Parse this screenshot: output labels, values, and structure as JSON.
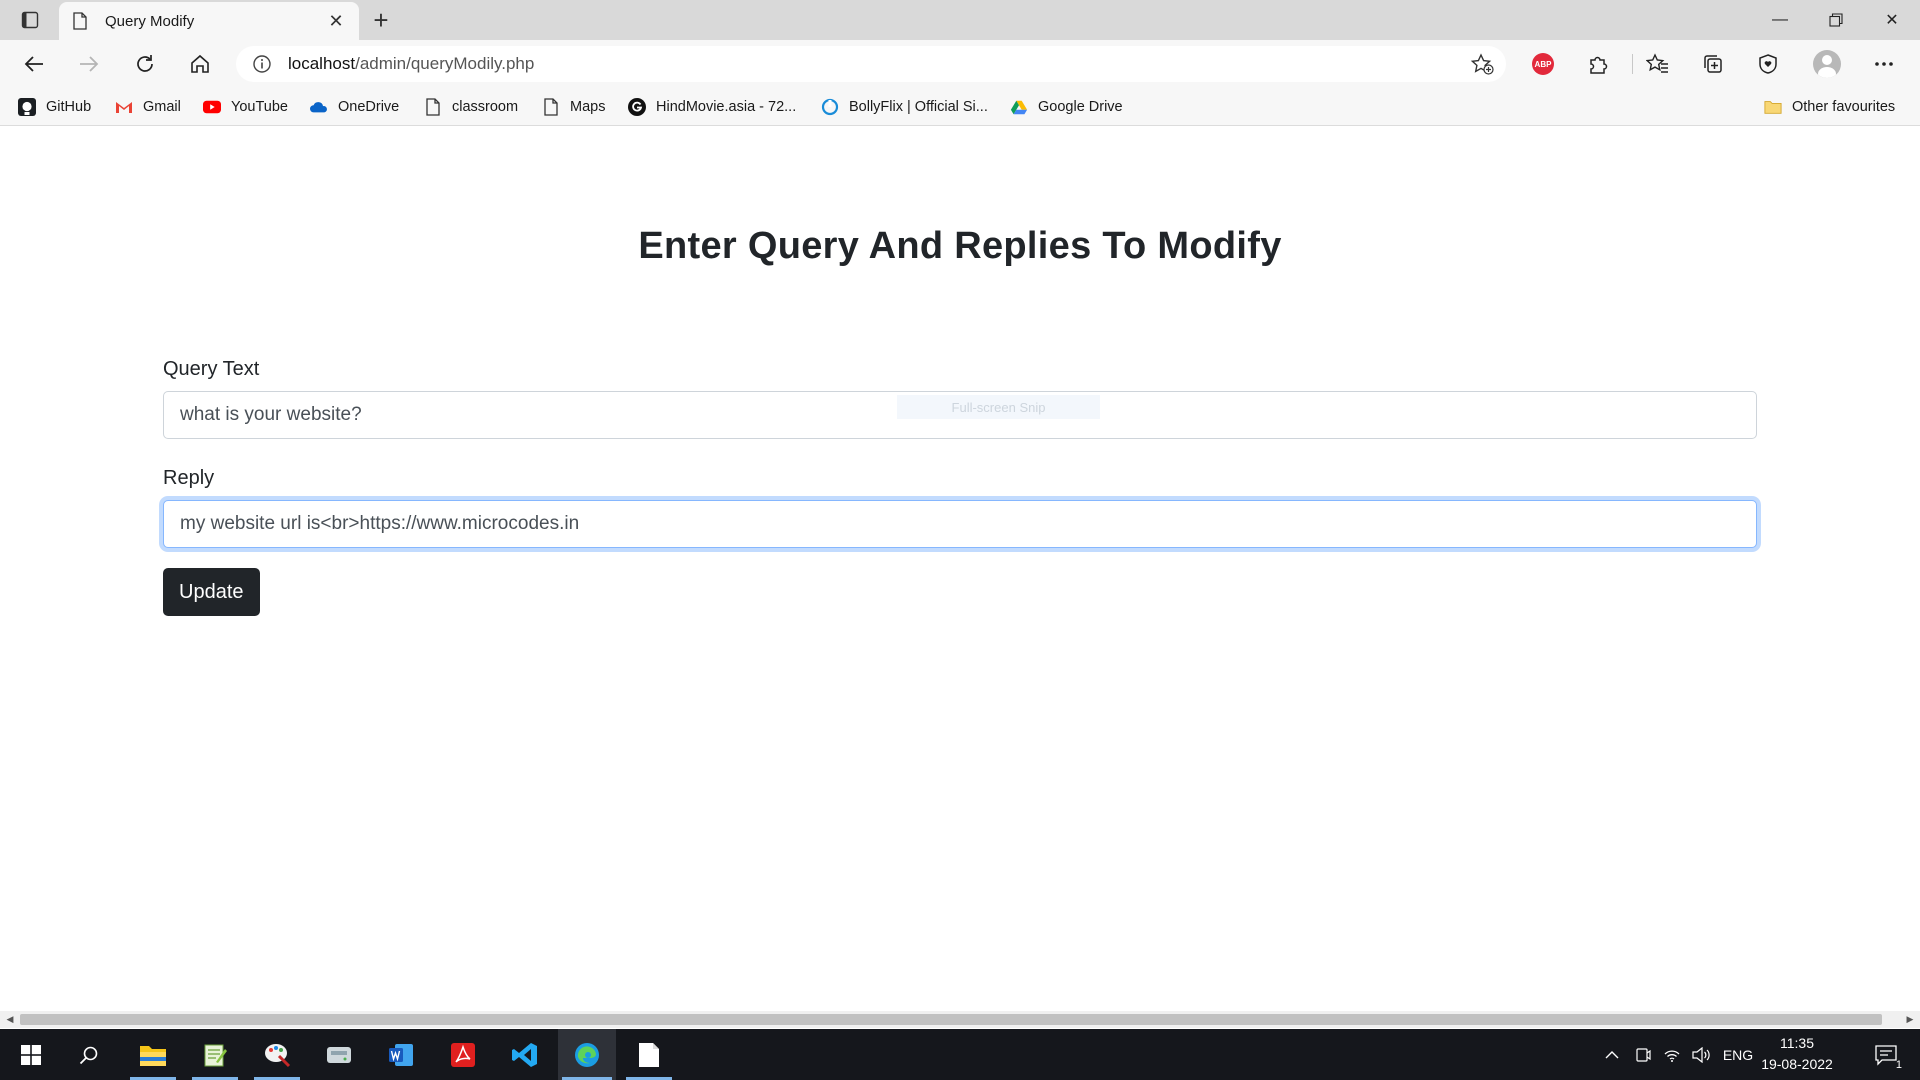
{
  "browser": {
    "tab_title": "Query Modify",
    "url_host": "localhost",
    "url_path": "/admin/queryModily.php",
    "abp_label": "ABP"
  },
  "favourites": [
    {
      "label": "GitHub",
      "icon": "github-icon"
    },
    {
      "label": "Gmail",
      "icon": "gmail-icon"
    },
    {
      "label": "YouTube",
      "icon": "youtube-icon"
    },
    {
      "label": "OneDrive",
      "icon": "onedrive-icon"
    },
    {
      "label": "classroom",
      "icon": "page-icon"
    },
    {
      "label": "Maps",
      "icon": "page-icon"
    },
    {
      "label": "HindMovie.asia - 72...",
      "icon": "g-icon"
    },
    {
      "label": "BollyFlix | Official Si...",
      "icon": "bollyflix-icon"
    },
    {
      "label": "Google Drive",
      "icon": "google-drive-icon"
    }
  ],
  "other_favourites": "Other favourites",
  "page": {
    "title": "Enter Query And Replies To Modify",
    "query_label": "Query Text",
    "query_value": "what is your website?",
    "reply_label": "Reply",
    "reply_value": "my website url is<br>https://www.microcodes.in",
    "update_button": "Update",
    "snip_overlay": "Full-screen Snip"
  },
  "taskbar": {
    "language": "ENG",
    "time": "11:35",
    "date": "19-08-2022",
    "notification_count": "1"
  },
  "colors": {
    "button_dark": "#212529",
    "focus_border": "#86b7fe",
    "taskbar": "#15171c"
  }
}
